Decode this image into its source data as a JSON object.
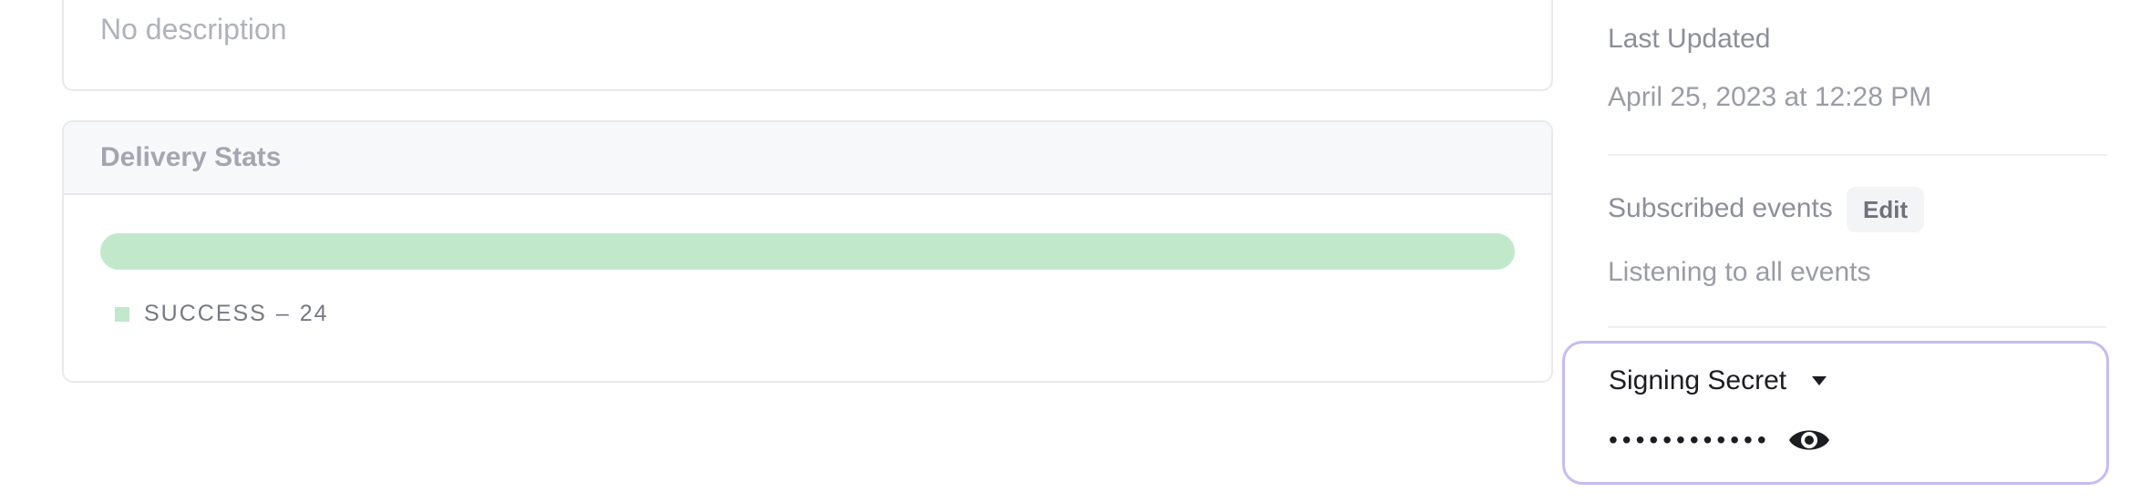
{
  "description_card": {
    "text": "No description"
  },
  "delivery_stats": {
    "title": "Delivery Stats",
    "success_fraction": 1.0,
    "bar_color": "#c1e8cb",
    "legend": {
      "label": "SUCCESS",
      "separator": "–",
      "count": "24"
    }
  },
  "sidebar": {
    "last_updated_label": "Last Updated",
    "last_updated_value": "April 25, 2023 at 12:28 PM",
    "subscribed_events_label": "Subscribed events",
    "edit_label": "Edit",
    "subscribed_events_value": "Listening to all events"
  },
  "signing_secret": {
    "label": "Signing Secret",
    "masked_value": "••••••••••••",
    "toggle_icon": "eye-icon",
    "dropdown_icon": "caret-down-icon",
    "border_color": "#c5bcf1"
  }
}
